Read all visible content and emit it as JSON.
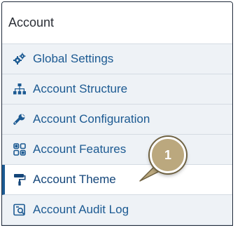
{
  "panel": {
    "title": "Account",
    "items": [
      {
        "label": "Global Settings",
        "icon": "gears-icon",
        "active": false
      },
      {
        "label": "Account Structure",
        "icon": "sitemap-icon",
        "active": false
      },
      {
        "label": "Account Configuration",
        "icon": "wrench-icon",
        "active": false
      },
      {
        "label": "Account Features",
        "icon": "features-icon",
        "active": false
      },
      {
        "label": "Account Theme",
        "icon": "paint-roller-icon",
        "active": true
      },
      {
        "label": "Account Audit Log",
        "icon": "audit-log-icon",
        "active": false
      }
    ]
  },
  "callout": {
    "number": "1"
  },
  "colors": {
    "link": "#1c5a92",
    "active_border": "#1c5a92",
    "item_bg": "#eef2f6",
    "callout_fill": "#bba87e"
  }
}
